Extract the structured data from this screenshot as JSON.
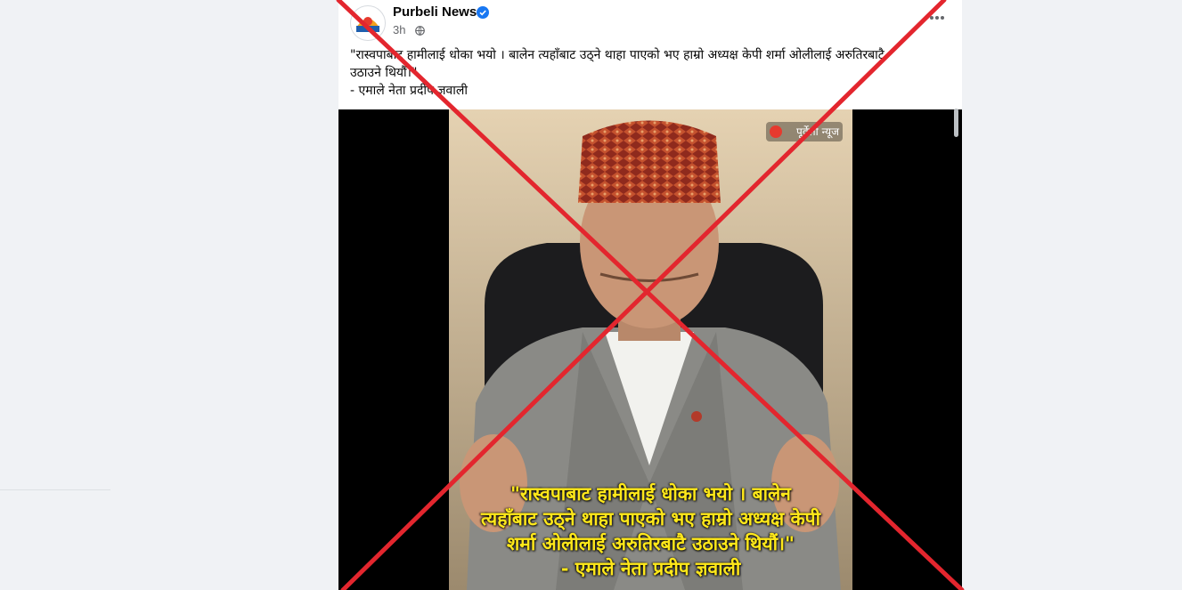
{
  "post": {
    "page_name": "Purbeli News",
    "time": "3h",
    "caption_lines": [
      "\"रास्वपाबाट हामीलाई धोका भयो । बालेन त्यहाँबाट उठ्ने थाहा पाएको भए हाम्रो अध्यक्ष केपी शर्मा ओलीलाई अरुतिरबाटै",
      "उठाउने थियौँ।\"",
      "- एमाले नेता प्रदीप ज्ञवाली"
    ],
    "icons": {
      "avatar": "purbeli-news-logo",
      "verified": "verified-badge-icon",
      "audience": "globe-icon",
      "more": "more-options-icon"
    }
  },
  "image": {
    "watermark": "पूर्वेली न्यूज",
    "quote_lines": [
      "\"रास्वपाबाट हामीलाई धोका भयो । बालेन",
      "त्यहाँबाट उठ्ने थाहा पाएको भए हाम्रो अध्यक्ष केपी",
      "शर्मा ओलीलाई अरुतिरबाटै उठाउने थियौं।\"",
      "- एमाले नेता प्रदीप ज्ञवाली"
    ]
  },
  "overlay": {
    "type": "red-x-cross",
    "color": "#e3262e"
  }
}
